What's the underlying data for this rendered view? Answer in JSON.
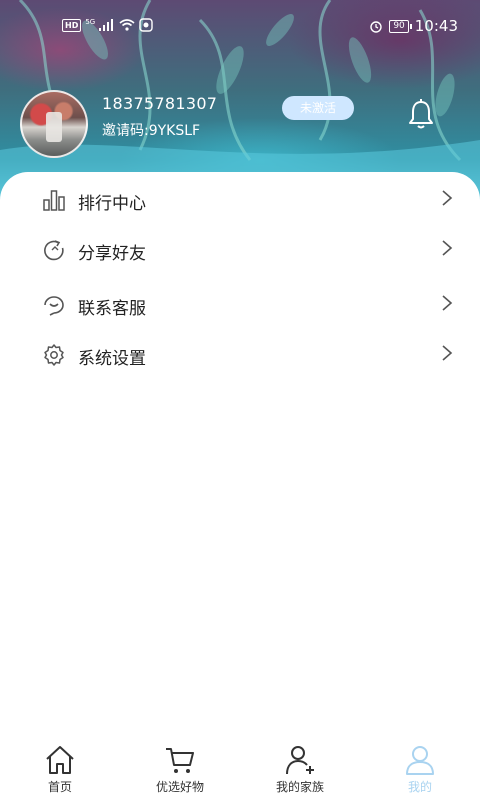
{
  "status_bar": {
    "hd": "HD",
    "network": "5G",
    "battery": "90",
    "time": "10:43"
  },
  "profile": {
    "phone": "18375781307",
    "invite_code": "邀请码:9YKSLF",
    "status_badge": "未激活"
  },
  "menu": [
    {
      "label": "排行中心",
      "icon": "bar-chart-icon"
    },
    {
      "label": "分享好友",
      "icon": "share-refresh-icon"
    },
    {
      "label": "联系客服",
      "icon": "customer-service-icon"
    },
    {
      "label": "系统设置",
      "icon": "gear-icon"
    }
  ],
  "bottom_nav": [
    {
      "label": "首页",
      "icon": "home-icon"
    },
    {
      "label": "优选好物",
      "icon": "cart-icon"
    },
    {
      "label": "我的家族",
      "icon": "add-user-icon"
    },
    {
      "label": "我的",
      "icon": "user-icon",
      "active": true
    }
  ],
  "colors": {
    "active_tab": "#a9d3f0",
    "badge_bg": "#cfe7ff",
    "text": "#222222"
  }
}
